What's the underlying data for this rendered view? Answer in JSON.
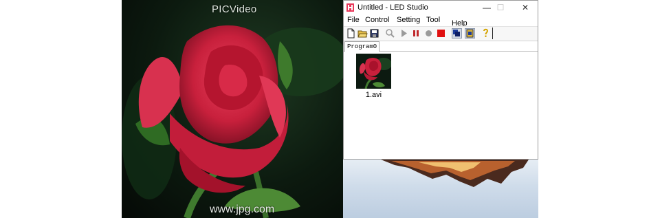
{
  "video": {
    "watermark_top": "PICVideo",
    "watermark_bottom": "www.jpg.com"
  },
  "window": {
    "title": "Untitled - LED Studio",
    "controls": {
      "minimize": "—",
      "maximize": "☐",
      "close": "✕"
    }
  },
  "menu": {
    "items": [
      "File",
      "Control",
      "Setting",
      "Tool",
      "Help"
    ]
  },
  "toolbar": {
    "buttons": [
      "new-file-icon",
      "open-folder-icon",
      "save-icon",
      "zoom-icon",
      "play-icon",
      "pause-icon",
      "stop-circle-icon",
      "stop-square-icon",
      "window-mode-icon",
      "layout-icon",
      "help-icon"
    ]
  },
  "tabs": [
    "Program0"
  ],
  "media": {
    "items": [
      {
        "name": "1.avi"
      }
    ]
  },
  "colors": {
    "rose": "#d0243f",
    "stop_red": "#e01010",
    "pause_red": "#c0282c",
    "window_border": "#9a9a9a"
  }
}
